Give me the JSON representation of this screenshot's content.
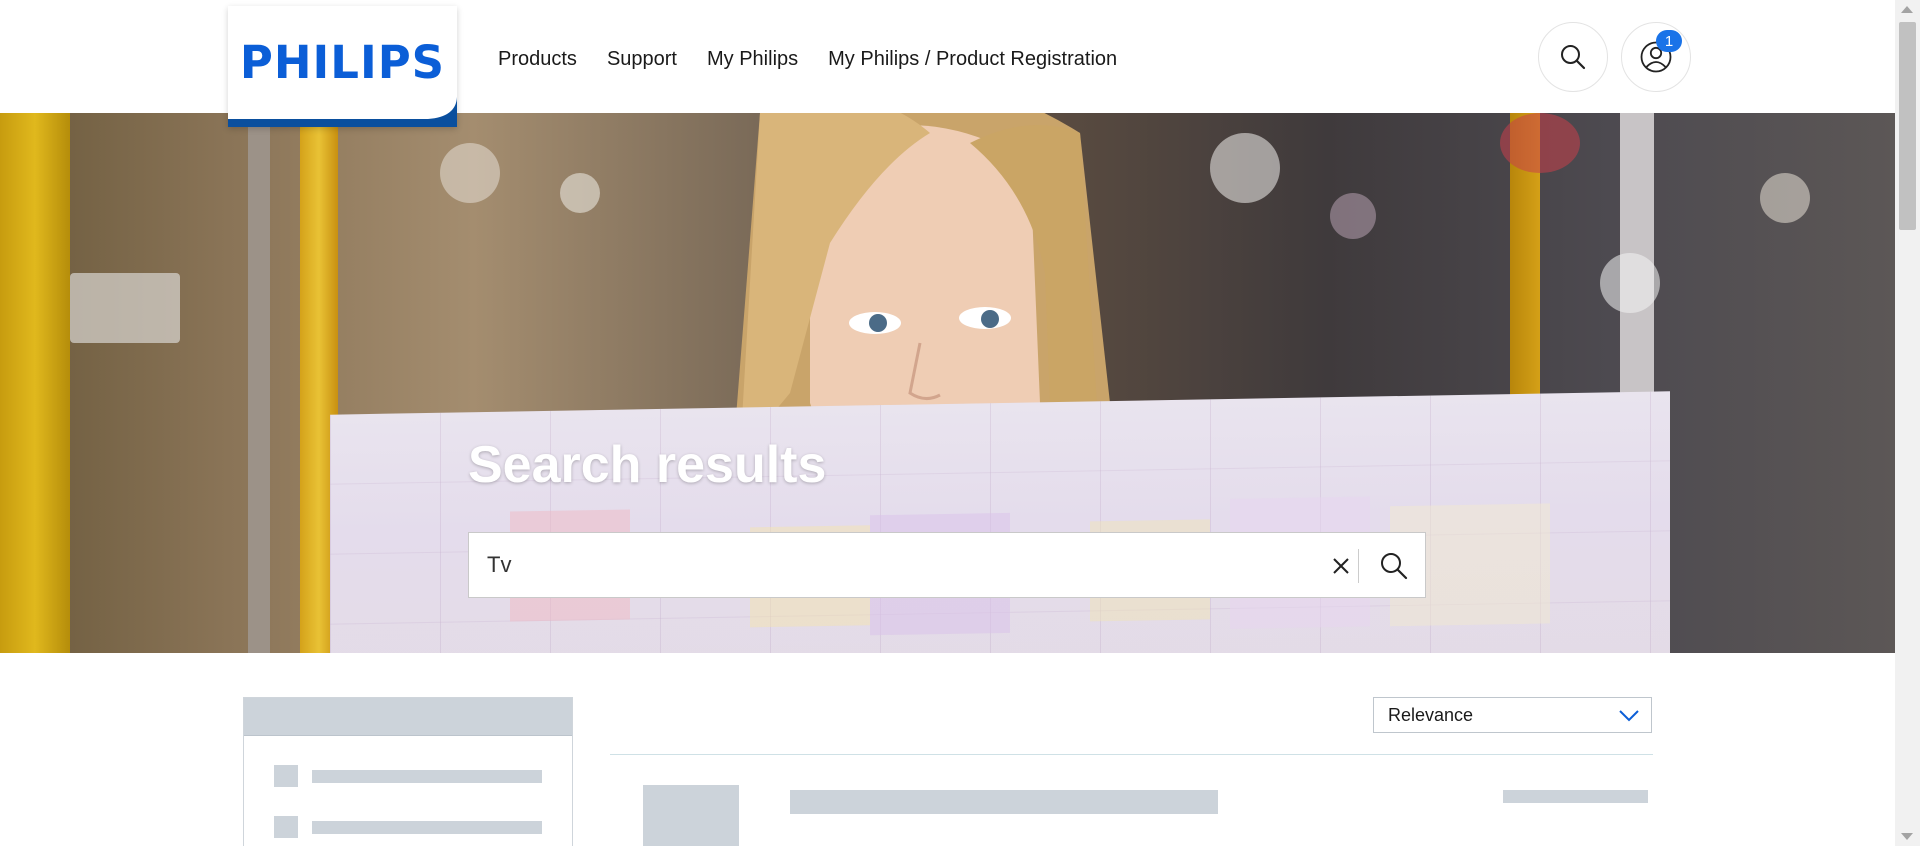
{
  "brand": {
    "logo_text": "PHILIPS",
    "primary_color": "#0b5ed7"
  },
  "nav": {
    "items": [
      {
        "label": "Products"
      },
      {
        "label": "Support"
      },
      {
        "label": "My Philips"
      },
      {
        "label": "My Philips / Product Registration"
      }
    ]
  },
  "header_actions": {
    "search_icon": "search-icon",
    "account_icon": "user-icon",
    "notification_count": "1"
  },
  "hero": {
    "title": "Search results",
    "search_value": "Tv",
    "clear_icon": "close-icon",
    "submit_icon": "search-icon"
  },
  "sort": {
    "selected": "Relevance",
    "icon": "chevron-down-icon"
  }
}
